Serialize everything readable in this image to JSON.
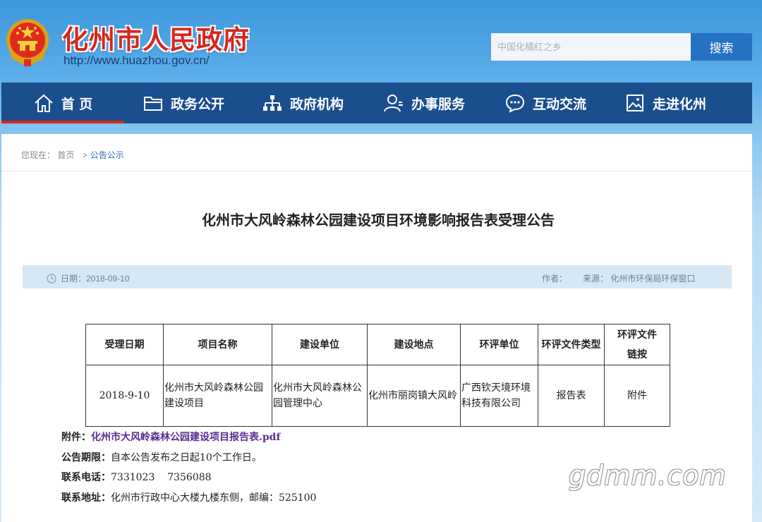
{
  "header": {
    "site_title": "化州市人民政府",
    "site_url": "http://www.huazhou.gov.cn/",
    "search_placeholder": "中国化橘红之乡",
    "search_button": "搜索"
  },
  "nav": {
    "items": [
      {
        "label": "首 页",
        "icon": "home-icon",
        "active": true
      },
      {
        "label": "政务公开",
        "icon": "folder-icon"
      },
      {
        "label": "政府机构",
        "icon": "org-chart-icon"
      },
      {
        "label": "办事服务",
        "icon": "user-icon"
      },
      {
        "label": "互动交流",
        "icon": "chat-icon"
      },
      {
        "label": "走进化州",
        "icon": "picture-icon"
      }
    ],
    "active_color": "#d7261e",
    "bg_color": "#1b4e8f"
  },
  "breadcrumb": {
    "prefix": "您现在：",
    "home": "首页",
    "separator": ">",
    "current": "公告公示"
  },
  "article": {
    "title": "化州市大风岭森林公园建设项目环境影响报告表受理公告",
    "date_label": "日期：2018-09-10",
    "author_label": "作者：",
    "source_label": "来源：  化州市环保局环保窗口"
  },
  "table": {
    "headers": [
      "受理日期",
      "项目名称",
      "建设单位",
      "建设地点",
      "环评单位",
      "环评文件类型",
      "环评文件链按"
    ],
    "row": [
      "2018-9-10",
      "化州市大风岭森林公园建设项目",
      "化州市大风岭森林公园管理中心",
      "化州市丽岗镇大风岭",
      "广西钦天境环境科技有限公司",
      "报告表",
      "附件"
    ]
  },
  "notes": {
    "attachment_key": "附件：",
    "attachment_link": "化州市大风岭森林公园建设项目报告表.pdf",
    "period_key": "公告期限：",
    "period_value": "自本公告发布之日起10个工作日。",
    "phone_key": "联系电话：",
    "phone_value": "7331023    7356088",
    "address_key": "联系地址：",
    "address_value": "化州市行政中心大楼九楼东侧，邮编：525100"
  },
  "watermark": "gdmm.com"
}
